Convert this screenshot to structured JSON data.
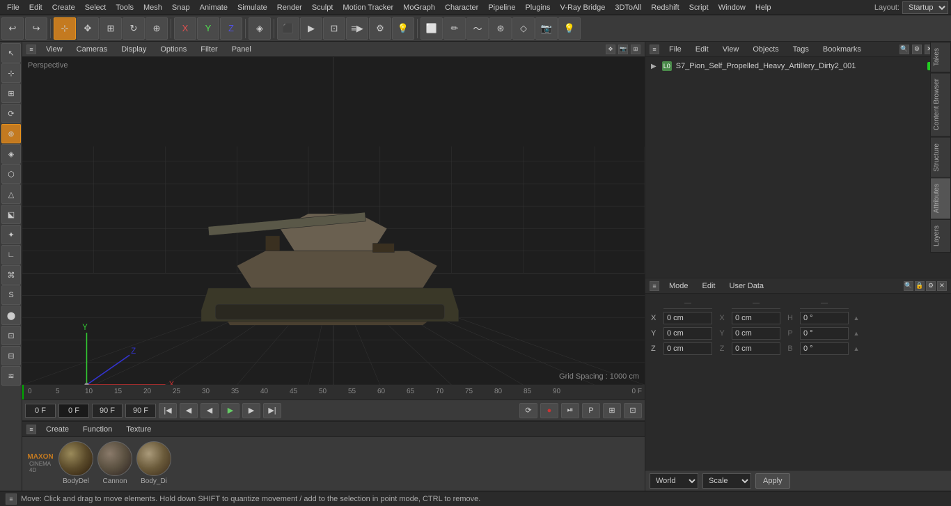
{
  "menuBar": {
    "items": [
      "File",
      "Edit",
      "Create",
      "Select",
      "Tools",
      "Mesh",
      "Snap",
      "Animate",
      "Simulate",
      "Render",
      "Sculpt",
      "Motion Tracker",
      "MoGraph",
      "Character",
      "Pipeline",
      "Plugins",
      "V-Ray Bridge",
      "3DToAll",
      "Redshift",
      "Script",
      "Window",
      "Help"
    ],
    "layout_label": "Layout:",
    "layout_value": "Startup"
  },
  "viewport": {
    "label": "Perspective",
    "menus": [
      "View",
      "Cameras",
      "Display",
      "Options",
      "Filter",
      "Panel"
    ],
    "grid_spacing": "Grid Spacing : 1000 cm"
  },
  "timeline": {
    "markers": [
      "0",
      "5",
      "10",
      "15",
      "20",
      "25",
      "30",
      "35",
      "40",
      "45",
      "50",
      "55",
      "60",
      "65",
      "70",
      "75",
      "80",
      "85",
      "90"
    ],
    "frame_start": "0 F",
    "frame_end": "90 F",
    "current_frame": "0 F",
    "frame_display": "0 F"
  },
  "objectPanel": {
    "menus": [
      "File",
      "Edit",
      "View",
      "Objects",
      "Tags",
      "Bookmarks"
    ],
    "object_name": "S7_Pion_Self_Propelled_Heavy_Artillery_Dirty2_001"
  },
  "attributesPanel": {
    "menus": [
      "Mode",
      "Edit",
      "User Data"
    ],
    "coords": {
      "headers": [
        "",
        ""
      ],
      "rows": [
        {
          "label": "X",
          "val1": "0 cm",
          "sep1": "X",
          "val2": "0 cm",
          "sep2": "H",
          "val3": "0 °"
        },
        {
          "label": "Y",
          "val1": "0 cm",
          "sep1": "Y",
          "val2": "0 cm",
          "sep2": "P",
          "val3": "0 °"
        },
        {
          "label": "Z",
          "val1": "0 cm",
          "sep1": "Z",
          "val2": "0 cm",
          "sep2": "B",
          "val3": "0 °"
        }
      ]
    },
    "world_label": "World",
    "scale_label": "Scale",
    "apply_label": "Apply"
  },
  "materials": {
    "menus": [
      "Create",
      "Function",
      "Texture"
    ],
    "items": [
      {
        "label": "BodyDel",
        "color": "#7a6a3a"
      },
      {
        "label": "Cannon",
        "color": "#6a6050"
      },
      {
        "label": "Body_Di",
        "color": "#8a7a5a"
      }
    ]
  },
  "statusBar": {
    "text": "Move: Click and drag to move elements. Hold down SHIFT to quantize movement / add to the selection in point mode, CTRL to remove."
  },
  "rightTabs": [
    "Takes",
    "Content Browser",
    "Structure",
    "Attributes",
    "Layers"
  ],
  "icons": {
    "undo": "↩",
    "move": "✥",
    "scale": "⊞",
    "rotate": "↻",
    "x_axis": "X",
    "y_axis": "Y",
    "z_axis": "Z",
    "object_mode": "◈",
    "render": "▶",
    "play": "▶",
    "stop": "■",
    "record": "●",
    "prev_frame": "◀",
    "next_frame": "▶",
    "first_frame": "◀◀",
    "last_frame": "▶▶"
  }
}
